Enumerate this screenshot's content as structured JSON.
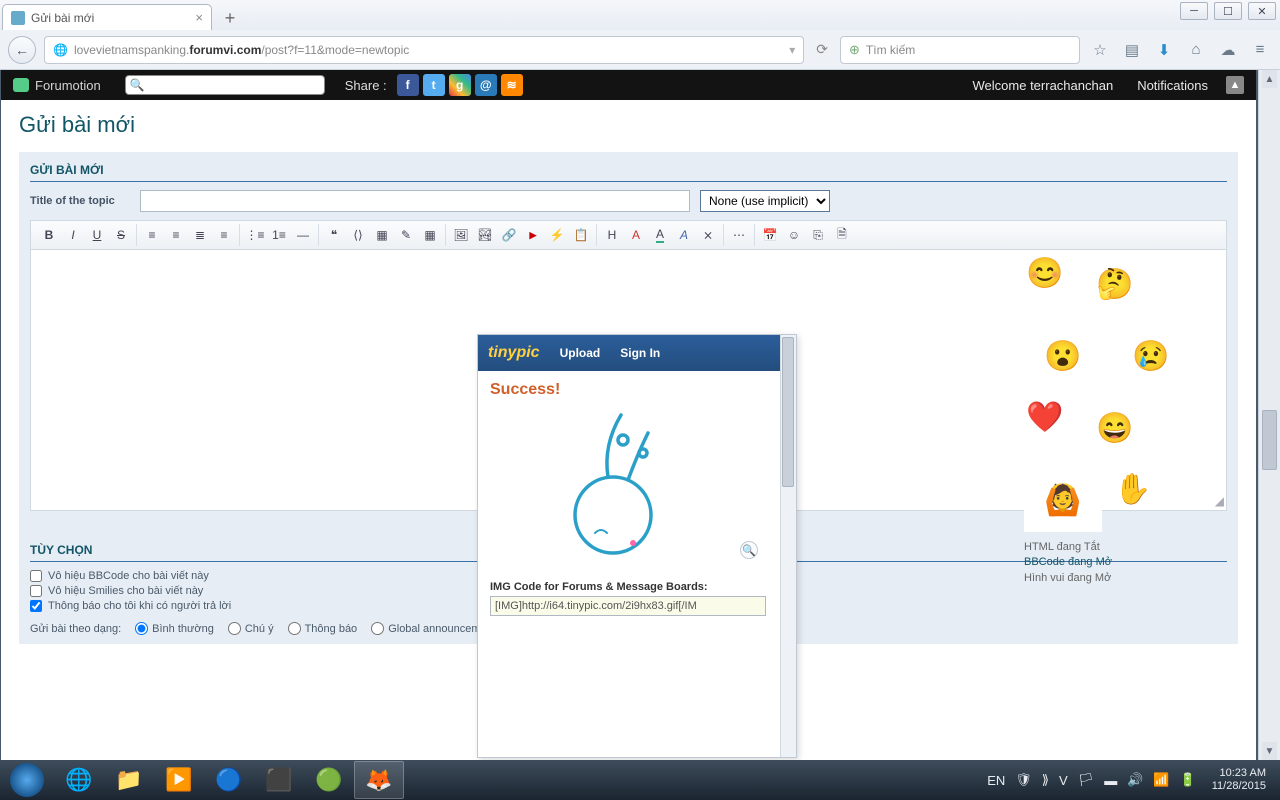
{
  "browser": {
    "tab_title": "Gửi bài mới",
    "url_pre": "lovevietnamspanking.",
    "url_host": "forumvi.com",
    "url_path": "/post?f=11&mode=newtopic",
    "search_placeholder": "Tìm kiếm"
  },
  "forum_header": {
    "brand": "Forumotion",
    "share": "Share :",
    "welcome": "Welcome terrachanchan",
    "notifications": "Notifications"
  },
  "page": {
    "title": "Gửi bài mới",
    "section": "GỬI BÀI MỚI",
    "topic_label": "Title of the topic",
    "title_value": "",
    "icon_select": "None (use implicit)"
  },
  "editor": {
    "buttons": [
      "B",
      "I",
      "U",
      "S",
      "≡",
      "≡",
      "≣",
      "≡",
      "⋮",
      "⋮",
      "⇥",
      "❝",
      "↺",
      "▦",
      "✎",
      "▤",
      "🖼",
      "⧉",
      "🔗",
      "▶",
      "A",
      "✦",
      "H",
      "A",
      "Tᴛ",
      "A",
      "⨯",
      "…",
      "📅",
      "☺",
      "⎘",
      "🗎"
    ]
  },
  "tinypic": {
    "logo_a": "tiny",
    "logo_b": "pic",
    "upload": "Upload",
    "signin": "Sign In",
    "success": "Success!",
    "code_label": "IMG Code for Forums & Message Boards:",
    "code_value": "[IMG]http://i64.tinypic.com/2i9hx83.gif[/IM"
  },
  "smilies_status": {
    "html": "HTML đang Tắt",
    "bbcode_a": "BBCode",
    "bbcode_b": " đang Mở",
    "fun": "Hình vui đang Mở"
  },
  "options": {
    "section": "TÙY CHỌN",
    "bbcode_off": "Vô hiệu BBCode cho bài viết này",
    "smilies_off": "Vô hiệu Smilies cho bài viết này",
    "notify": "Thông báo cho tôi khi có người trả lời",
    "postas_label": "Gửi bài theo dạng:",
    "normal": "Bình thường",
    "note": "Chú ý",
    "announce": "Thông báo",
    "global": "Global announcement"
  },
  "taskbar": {
    "lang": "EN",
    "time": "10:23 AM",
    "date": "11/28/2015"
  }
}
